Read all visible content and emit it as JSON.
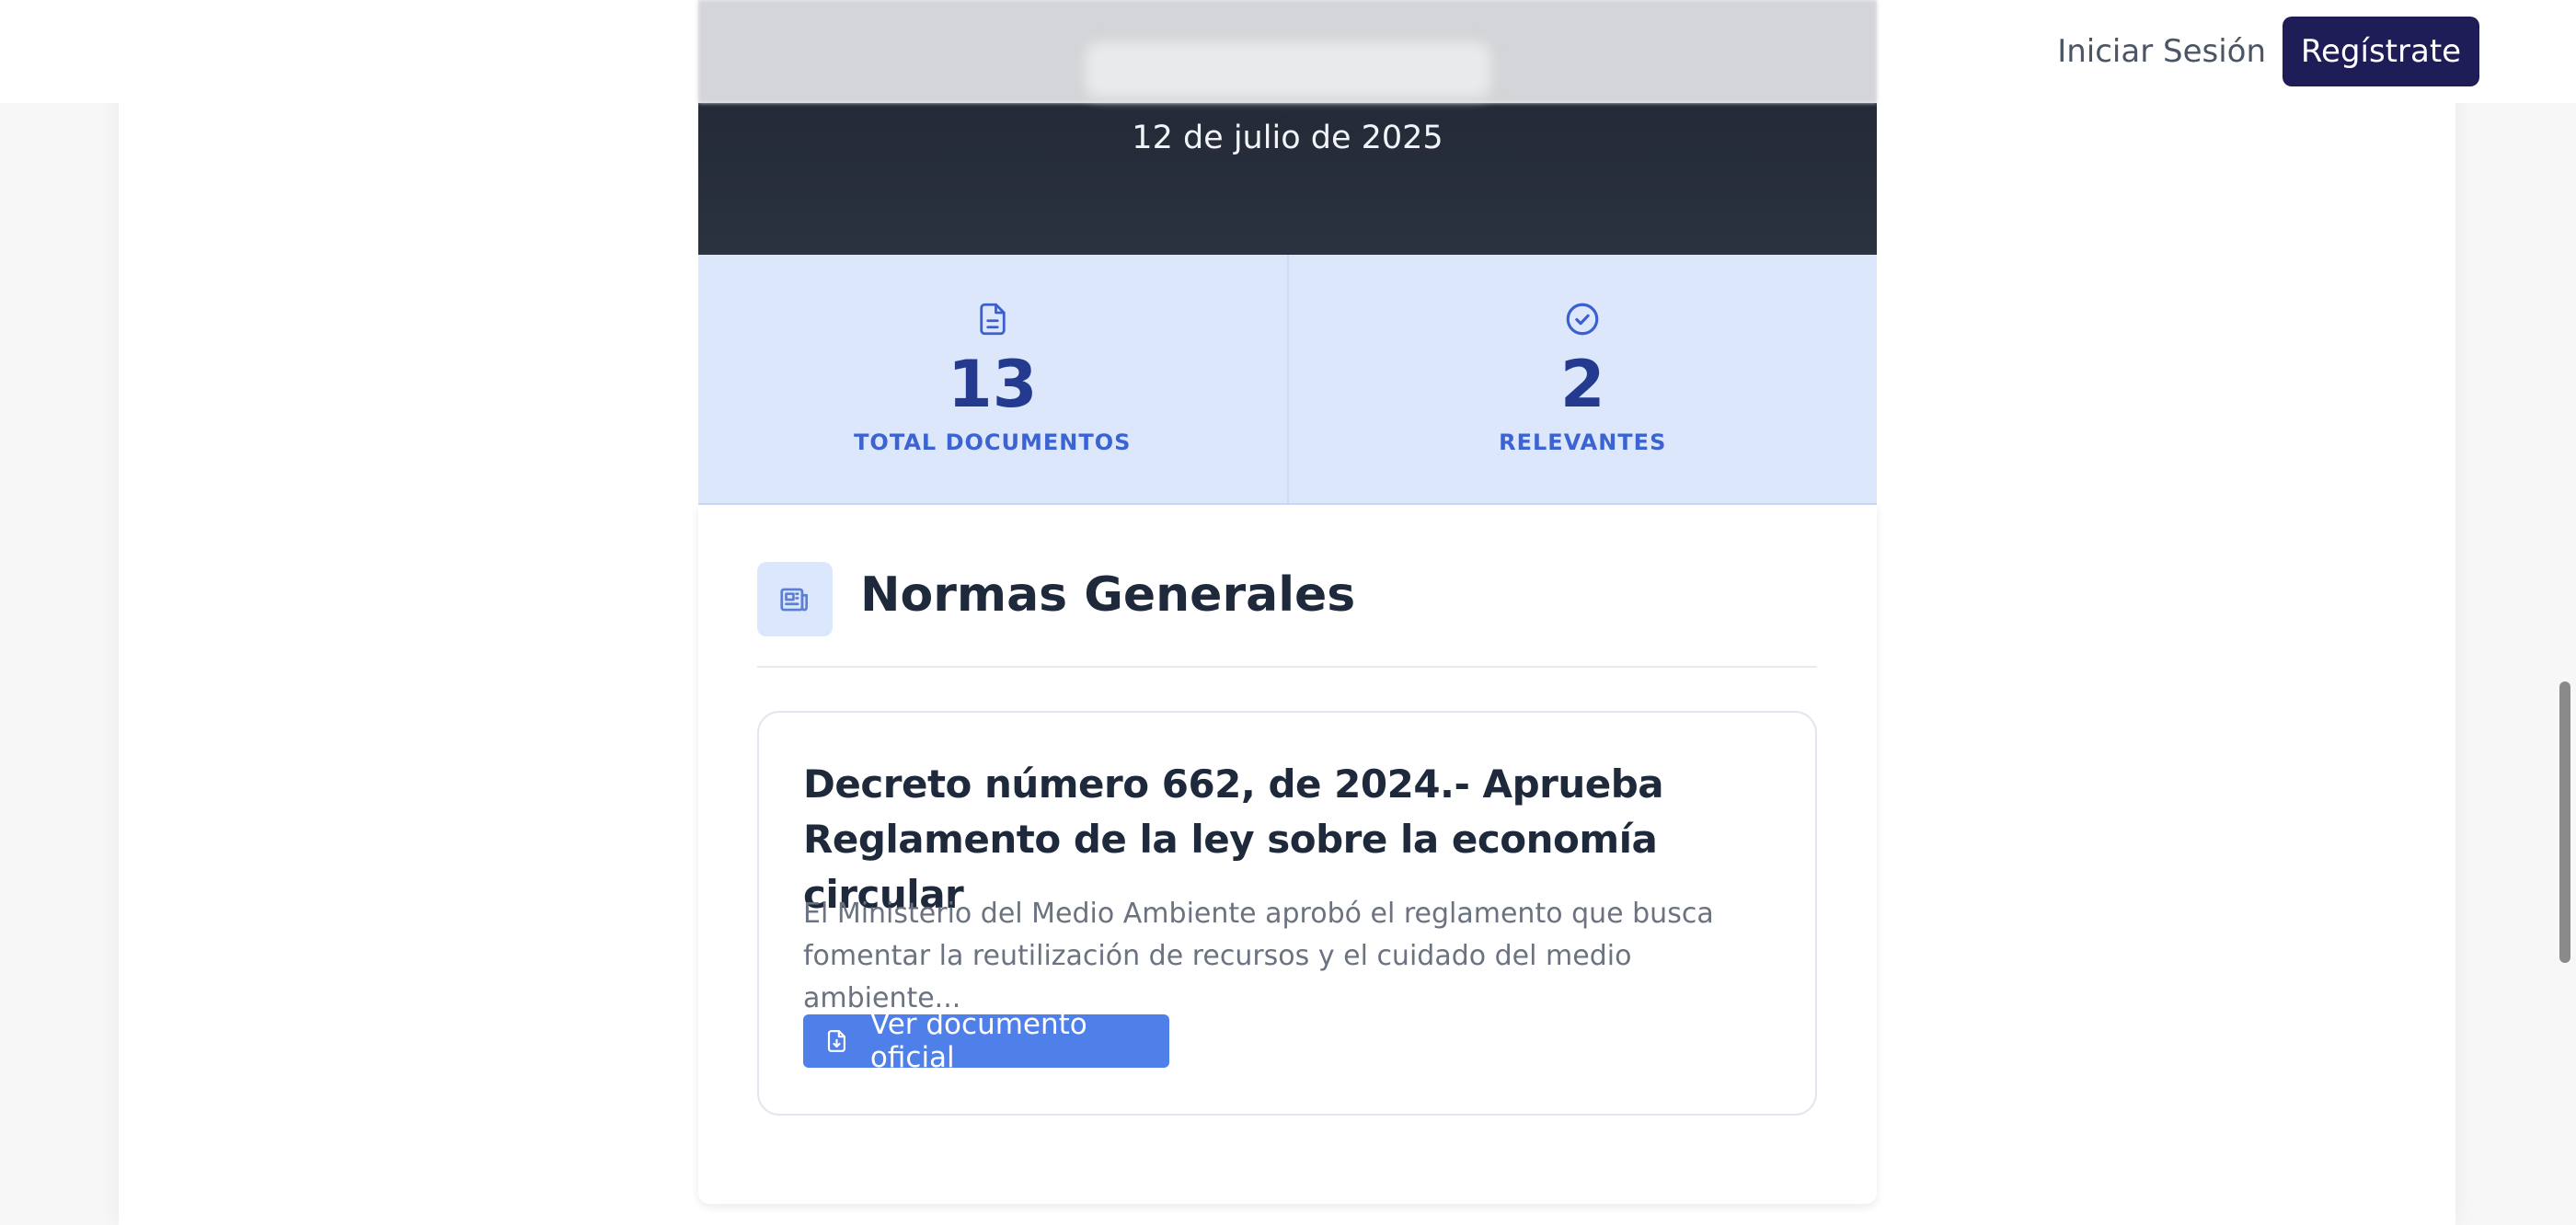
{
  "header": {
    "login_label": "Iniciar Sesión",
    "signup_label": "Regístrate"
  },
  "hero": {
    "date": "12 de julio de 2025"
  },
  "stats": [
    {
      "icon": "document-icon",
      "value": "13",
      "label": "TOTAL DOCUMENTOS"
    },
    {
      "icon": "check-circle-icon",
      "value": "2",
      "label": "RELEVANTES"
    }
  ],
  "section": {
    "icon": "newspaper-icon",
    "title": "Normas Generales"
  },
  "document": {
    "title": "Decreto número 662, de 2024.- Aprueba Reglamento de la ley sobre la economía circular",
    "summary": "El Ministerio del Medio Ambiente aprobó el reglamento que busca fomentar la reutilización de recursos y el cuidado del medio ambiente...",
    "button_icon": "file-download-icon",
    "button_label": "Ver documento oficial"
  },
  "colors": {
    "brand_dark": "#1f1d57",
    "accent_blue": "#4f7fe8",
    "stat_bg": "#dde7fb",
    "stat_value": "#233a8f"
  }
}
